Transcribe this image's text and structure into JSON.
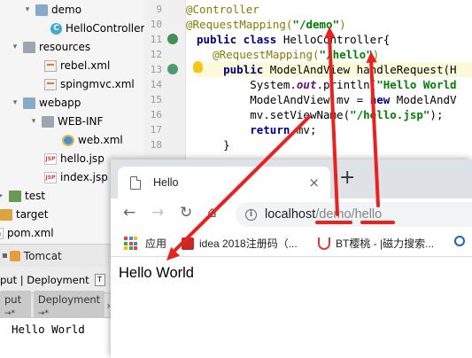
{
  "project_tree": {
    "items": [
      {
        "label": "demo",
        "icon": "folder-icon",
        "arrow": "▾"
      },
      {
        "label": "HelloController",
        "icon": "class-icon",
        "arrow": ""
      },
      {
        "label": "resources",
        "icon": "folder-icon",
        "arrow": "▾"
      },
      {
        "label": "rebel.xml",
        "icon": "xml-file-icon",
        "arrow": ""
      },
      {
        "label": "spingmvc.xml",
        "icon": "xml-file-icon",
        "arrow": ""
      },
      {
        "label": "webapp",
        "icon": "folder-icon",
        "arrow": "▾"
      },
      {
        "label": "WEB-INF",
        "icon": "folder-icon",
        "arrow": "▾"
      },
      {
        "label": "web.xml",
        "icon": "web-xml-icon",
        "arrow": ""
      },
      {
        "label": "hello.jsp",
        "icon": "jsp-file-icon",
        "arrow": ""
      },
      {
        "label": "index.jsp",
        "icon": "jsp-file-icon",
        "arrow": ""
      },
      {
        "label": "test",
        "icon": "folder-icon",
        "arrow": "▸"
      },
      {
        "label": "target",
        "icon": "folder-icon",
        "arrow": "▸"
      },
      {
        "label": "pom.xml",
        "icon": "maven-file-icon",
        "arrow": ""
      }
    ]
  },
  "editor": {
    "line_numbers": [
      "9",
      "10",
      "11",
      "12",
      "13",
      "14",
      "15",
      "16",
      "17",
      "18"
    ],
    "lines": [
      {
        "a": "@Controller"
      },
      {
        "a": "@RequestMapping(",
        "s": "\"/demo\"",
        "e": ")"
      },
      {
        "k": "public class ",
        "t": "HelloController{"
      },
      {
        "pre": "    ",
        "a": "@RequestMapping(",
        "s": "\"/hello\"",
        "e": ")"
      },
      {
        "pre": "    ",
        "k": "public ",
        "t": "ModelAndView handleRequest(H"
      },
      {
        "pre": "        ",
        "t": "System.",
        "f": "out",
        "t2": ".println(",
        "s": "\"Hello World"
      },
      {
        "pre": "        ",
        "t": "ModelAndView mv = ",
        "k": "new ",
        "t2": "ModelAndV"
      },
      {
        "pre": "        ",
        "t": "mv.setViewName(",
        "s": "\"/hello.jsp\"",
        "e": ");"
      },
      {
        "pre": "        ",
        "k": "return ",
        "t": "mv;"
      },
      {
        "pre": "    ",
        "t": "}"
      }
    ]
  },
  "tomcat_panel": {
    "title": "Tomcat",
    "tab_label": "put | Deployment",
    "tab2_label": "T",
    "subtabs": [
      "put",
      "Deployment"
    ],
    "subtab_arrow": "→*",
    "more": "›",
    "console_output": "Hello World"
  },
  "browser": {
    "tab_title": "Hello",
    "tab_close": "×",
    "new_tab": "+",
    "url_host": "localhost",
    "url_path_1": "/demo",
    "url_path_2": "/hello",
    "info_icon": "i",
    "back_icon": "←",
    "forward_icon": "→",
    "reload_icon": "↻",
    "home_icon": "⌂",
    "bookmarks": [
      {
        "label": "应用",
        "icon": "apps-icon"
      },
      {
        "label": "idea 2018注册码（...",
        "icon": "idea-bookmark-icon"
      },
      {
        "label": "BT樱桃 - |磁力搜索...",
        "icon": "magnet-bookmark-icon"
      }
    ],
    "page_text": "Hello World"
  },
  "colors": {
    "annotation_red": "#e8231f",
    "annotation_stroke": "#ff3b30"
  }
}
